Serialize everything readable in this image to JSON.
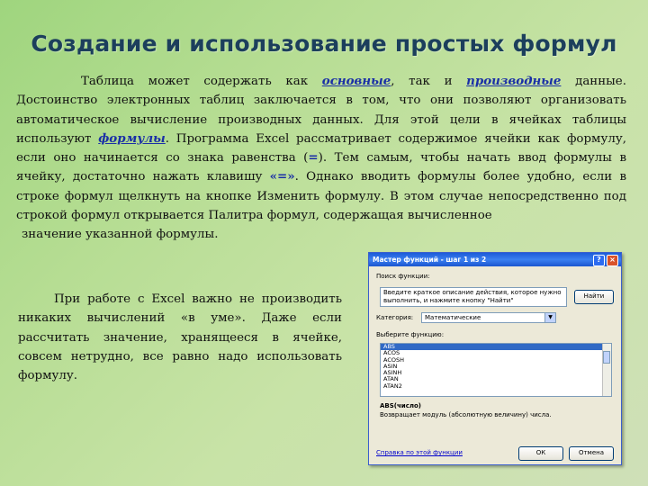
{
  "title": "Создание и использование простых формул",
  "para1": {
    "s1": "Таблица может содержать как ",
    "w_basic": "основные",
    "s2": ", так и ",
    "w_derived": "производные",
    "s3": " данные. Достоинство электронных таблиц заключается в том, что они позволяют организовать автоматическое вычисление производных данных. Для этой цели в ячейках таблицы используют ",
    "w_formulas": "формулы",
    "s4": ". Программа Excel рассматривает содержимое ячейки как формулу, если оно начинается со знака равенства (",
    "w_eq": "=",
    "s5": "). Тем самым, чтобы начать ввод формулы в ячейку, достаточно нажать клавишу ",
    "w_key": "«=»",
    "s6": ". Однако вводить формулы более удобно, если в строке формул щелкнуть на кнопке  Изменить формулу. В этом случае непосредственно под строкой формул открывается Палитра формул, содержащая вычисленное",
    "tail": "значение указанной формулы."
  },
  "para2": "При работе с Excel важно не производить никаких вычислений «в уме». Даже если рассчитать значение, хранящееся в ячейке, совсем нетрудно, все равно надо использовать формулу.",
  "dialog": {
    "title": "Мастер функций - шаг 1 из 2",
    "help_glyph": "?",
    "close_glyph": "×",
    "search_label": "Поиск функции:",
    "search_text": "Введите краткое описание действия, которое нужно выполнить, и нажмите кнопку \"Найти\"",
    "find_button": "Найти",
    "category_label": "Категория:",
    "category_value": "Математические",
    "select_label": "Выберите функцию:",
    "functions": [
      "ABS",
      "ACOS",
      "ACOSH",
      "ASIN",
      "ASINH",
      "ATAN",
      "ATAN2"
    ],
    "selected_function": "ABS",
    "signature": "ABS(число)",
    "description": "Возвращает модуль (абсолютную величину) числа.",
    "help_link": "Справка по этой функции",
    "ok_button": "ОК",
    "cancel_button": "Отмена"
  },
  "colors": {
    "title": "#1c3f5c",
    "highlight": "#1a2fa6",
    "dialog_titlebar": "#1d5bd8"
  }
}
